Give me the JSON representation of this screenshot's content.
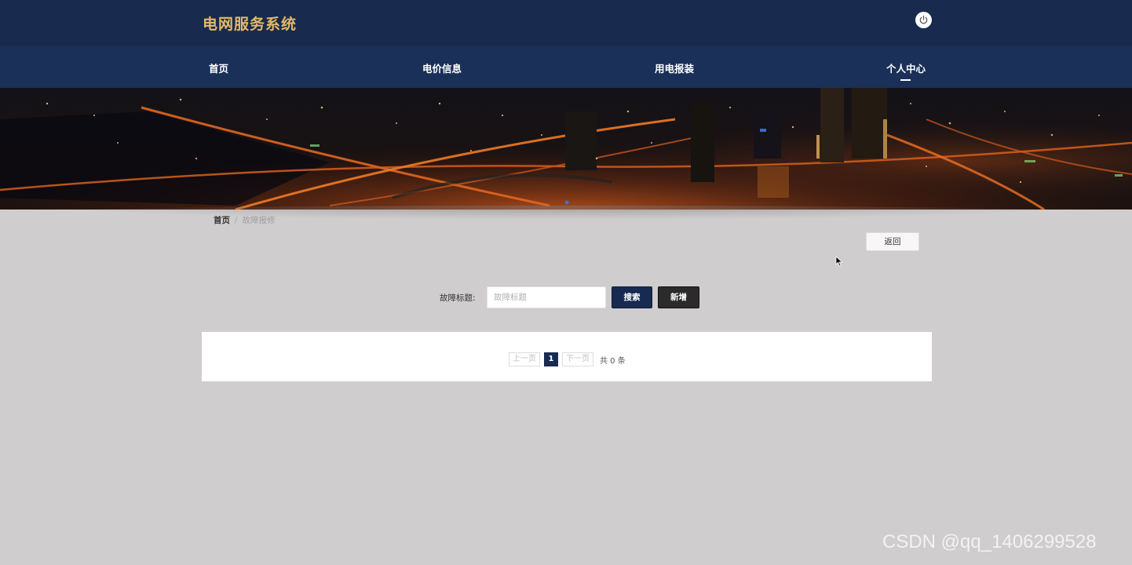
{
  "header": {
    "brand_title": "电网服务系统",
    "power_icon": "power-icon"
  },
  "nav": {
    "items": [
      {
        "label": "首页",
        "active": false
      },
      {
        "label": "电价信息",
        "active": false
      },
      {
        "label": "用电报装",
        "active": false
      },
      {
        "label": "个人中心",
        "active": true
      }
    ]
  },
  "banner": {
    "image": "night city highway aerial",
    "carousel_dots": 1
  },
  "breadcrumb": {
    "home": "首页",
    "separator": "/",
    "current": "故障报修"
  },
  "actions": {
    "back_label": "返回"
  },
  "search": {
    "label": "故障标题:",
    "placeholder": "故障标题",
    "value": "",
    "search_label": "搜索",
    "add_label": "新增"
  },
  "pagination": {
    "prev_label": "上一页",
    "current_page": "1",
    "next_label": "下一页",
    "total_text": "共 0 条"
  },
  "watermark": "CSDN @qq_1406299528",
  "colors": {
    "header_bg": "#182a4d",
    "nav_bg": "#1a3058",
    "brand": "#e3b96a",
    "page_bg": "#cfcdce",
    "primary_button": "#172a52",
    "dark_button": "#2b2b2b"
  }
}
